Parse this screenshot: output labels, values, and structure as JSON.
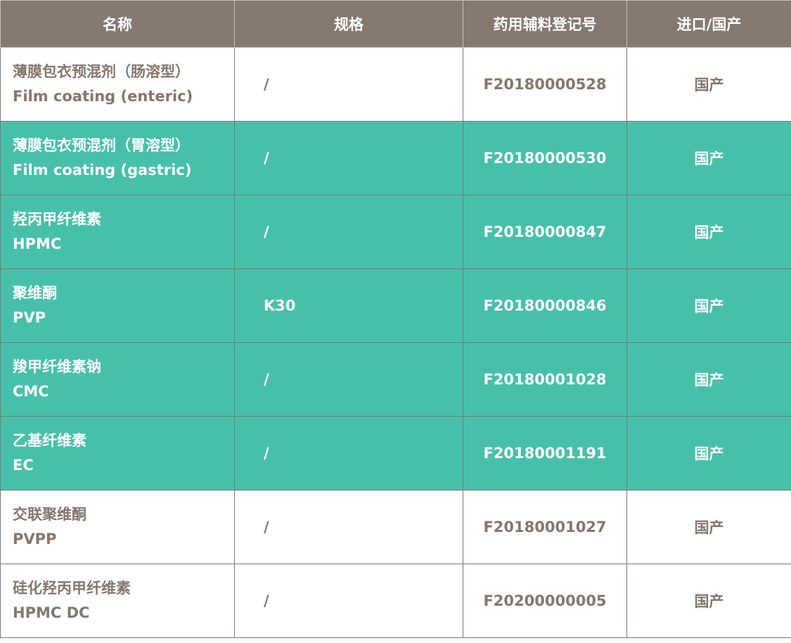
{
  "headers": {
    "name": "名称",
    "spec": "规格",
    "registration": "药用辅料登记号",
    "origin": "进口/国产"
  },
  "colors": {
    "header_bg": "#857970",
    "highlight_bg": "#47c0aa",
    "plain_text": "#85776c",
    "highlight_text": "#ffffff"
  },
  "rows": [
    {
      "name_cn": "薄膜包衣预混剂（肠溶型）",
      "name_en": "Film coating (enteric)",
      "spec": "/",
      "registration": "F20180000528",
      "origin": "国产",
      "highlighted": false
    },
    {
      "name_cn": "薄膜包衣预混剂（胃溶型）",
      "name_en": "Film coating (gastric)",
      "spec": "/",
      "registration": "F20180000530",
      "origin": "国产",
      "highlighted": true
    },
    {
      "name_cn": "羟丙甲纤维素",
      "name_en": "HPMC",
      "spec": "/",
      "registration": "F20180000847",
      "origin": "国产",
      "highlighted": true
    },
    {
      "name_cn": "聚维酮",
      "name_en": "PVP",
      "spec": "K30",
      "registration": "F20180000846",
      "origin": "国产",
      "highlighted": true
    },
    {
      "name_cn": "羧甲纤维素钠",
      "name_en": "CMC",
      "spec": "/",
      "registration": "F20180001028",
      "origin": "国产",
      "highlighted": true
    },
    {
      "name_cn": "乙基纤维素",
      "name_en": "EC",
      "spec": "/",
      "registration": "F20180001191",
      "origin": "国产",
      "highlighted": true
    },
    {
      "name_cn": "交联聚维酮",
      "name_en": "PVPP",
      "spec": "/",
      "registration": "F20180001027",
      "origin": "国产",
      "highlighted": false
    },
    {
      "name_cn": "硅化羟丙甲纤维素",
      "name_en": "HPMC DC",
      "spec": "/",
      "registration": "F20200000005",
      "origin": "国产",
      "highlighted": false
    }
  ]
}
